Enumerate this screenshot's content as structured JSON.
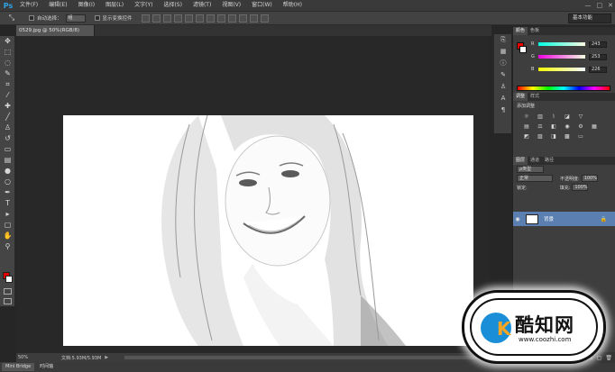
{
  "app": {
    "logo": "Ps"
  },
  "menu": [
    "文件(F)",
    "编辑(E)",
    "图像(I)",
    "图层(L)",
    "文字(Y)",
    "选择(S)",
    "滤镜(T)",
    "视图(V)",
    "窗口(W)",
    "帮助(H)"
  ],
  "window_controls": [
    "—",
    "□",
    "✕"
  ],
  "options": {
    "auto_select_label": "自动选择：",
    "auto_select_value": "组",
    "show_transform_label": "显示变换控件",
    "workspace": "基本功能"
  },
  "document": {
    "tab_title": "0529.jpg @ 50%(RGB/8)"
  },
  "status": {
    "zoom": "50%",
    "doc_size": "文档:5.93M/5.93M"
  },
  "bottom_tabs": [
    "Mini Bridge",
    "时间轴"
  ],
  "color_panel": {
    "tabs": [
      "颜色",
      "色板"
    ],
    "channels": [
      {
        "name": "R",
        "value": "243"
      },
      {
        "name": "G",
        "value": "253"
      },
      {
        "name": "B",
        "value": "226"
      }
    ]
  },
  "adjustments": {
    "tabs": [
      "调整",
      "样式"
    ],
    "title": "添加调整"
  },
  "layers": {
    "tabs": [
      "图层",
      "通道",
      "路径"
    ],
    "kind_label": "ρ类型",
    "blend_mode": "正常",
    "opacity_label": "不透明度:",
    "opacity_value": "100%",
    "lock_label": "锁定:",
    "fill_label": "填充:",
    "fill_value": "100%",
    "layer_name": "背景"
  },
  "watermark": {
    "brand": "酷知网",
    "url": "www.coozhi.com"
  },
  "colors": {
    "foreground": "#e10000",
    "background": "#ffffff",
    "selected_layer": "#5a7fb0"
  }
}
